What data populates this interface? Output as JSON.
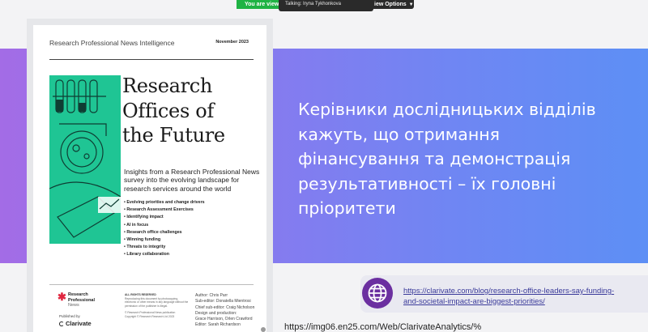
{
  "zoom": {
    "viewing_label": "You are viewi",
    "talking_label": "Talking: Iryna Tykhonkova",
    "view_options_label": "iew Options"
  },
  "slide": {
    "title_lines": [
      "Керівники дослідницьких відділів",
      "кажуть, що отримання",
      "фінансування та демонстрація",
      "результативності – їх головні",
      "пріоритети"
    ],
    "link_lines": [
      "https://clarivate.com/blog/research-office-leaders-say-funding-",
      "and-societal-impact-are-biggest-priorities/"
    ],
    "bottom_url": "https://img06.en25.com/Web/ClarivateAnalytics/%"
  },
  "cover": {
    "brand": "Research Professional News Intelligence",
    "date": "November 2023",
    "title_lines": [
      "Research",
      "Offices of",
      "the Future"
    ],
    "subtitle": "Insights from a Research Professional News survey into the evolving landscape for research services around the world",
    "toc": [
      "Evolving priorities and change drivers",
      "Research Assessment Exercises",
      "Identifying impact",
      "AI in focus",
      "Research office challenges",
      "Winning funding",
      "Threats to integrity",
      "Library collaboration"
    ],
    "logo_lines": [
      "Research",
      "Professional",
      "News"
    ],
    "published_by": "Published by",
    "publisher": "Clarivate",
    "fine_heading": "ALL RIGHTS RESERVED",
    "fine_text": "Reproducing this document by photocopying, electronic or other means in any language without the permission of the publisher is illegal.",
    "fine_footer": "© Research Professional News publication",
    "fine_copyright": "Copyright © Research Research Ltd 2023",
    "credits": [
      "Author: Chris Parr",
      "Sub-editor: Donatella Mientrosi",
      "Chief sub-editor: Craig Nicholson",
      "Design and production:",
      "Grace Harrison, Orlen Crawford",
      "Editor: Sarah Richardson"
    ]
  },
  "colors": {
    "zoom_green": "#1fb344",
    "banner_start": "#a36ce6",
    "banner_end": "#5d8ff5",
    "cover_art": "#1fc594",
    "link_text": "#3a3a9a",
    "globe": "#6b2fa0"
  },
  "icons": {
    "link": "globe-icon",
    "chevron": "chevron-down-icon"
  }
}
